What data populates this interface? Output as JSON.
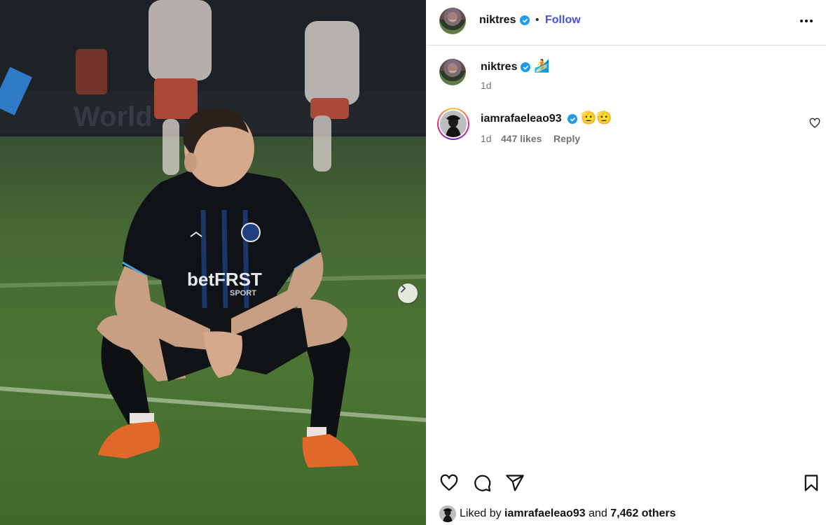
{
  "post": {
    "author": "niktres",
    "follow_label": "Follow",
    "separator": "•",
    "caption_time": "1d",
    "caption_emoji": "🏄",
    "verified_icon": "verified-badge-icon",
    "more_icon": "more-options-icon",
    "next_icon": "chevron-right-icon"
  },
  "comment": {
    "username": "iamrafaeleao93",
    "text": "🫡🫡",
    "time": "1d",
    "likes": "447 likes",
    "reply_label": "Reply",
    "like_icon": "heart-outline-icon"
  },
  "actions": {
    "like_icon": "heart-icon",
    "comment_icon": "comment-icon",
    "share_icon": "share-icon",
    "save_icon": "bookmark-icon"
  },
  "liked_by": {
    "prefix": "Liked by",
    "user": "iamrafaeleao93",
    "connector": "and",
    "others": "7,462 others"
  },
  "photo": {
    "kit_sponsor": "betFRST",
    "kit_sponsor_sub": "SPORT"
  },
  "colors": {
    "accent": "#4150f7",
    "verified": "#1d9bf0",
    "muted": "#737373",
    "divider": "#dbdbdb"
  }
}
